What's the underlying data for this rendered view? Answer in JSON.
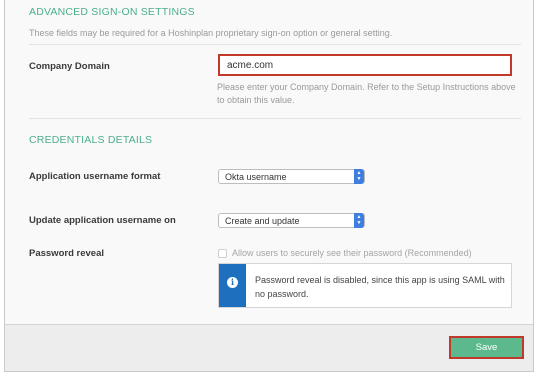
{
  "advanced": {
    "title": "ADVANCED SIGN-ON SETTINGS",
    "description": "These fields may be required for a Hoshinplan proprietary sign-on option or general setting.",
    "company_domain": {
      "label": "Company Domain",
      "value": "acme.com",
      "help": "Please enter your Company Domain. Refer to the Setup Instructions above to obtain this value."
    }
  },
  "credentials": {
    "title": "CREDENTIALS DETAILS",
    "username_format": {
      "label": "Application username format",
      "selected": "Okta username"
    },
    "update_username": {
      "label": "Update application username on",
      "selected": "Create and update"
    },
    "password_reveal": {
      "label": "Password reveal",
      "checkbox_label": "Allow users to securely see their password (Recommended)",
      "checked": false,
      "info_text": "Password reveal is disabled, since this app is using SAML with no password.",
      "info_icon": "info-icon"
    }
  },
  "footer": {
    "save_label": "Save"
  },
  "colors": {
    "section_title": "#4caf8a",
    "highlight_border": "#c0392b",
    "save_button": "#5cb98e",
    "select_arrow": "#3d7fe0",
    "info_stripe": "#1f6fbf"
  }
}
